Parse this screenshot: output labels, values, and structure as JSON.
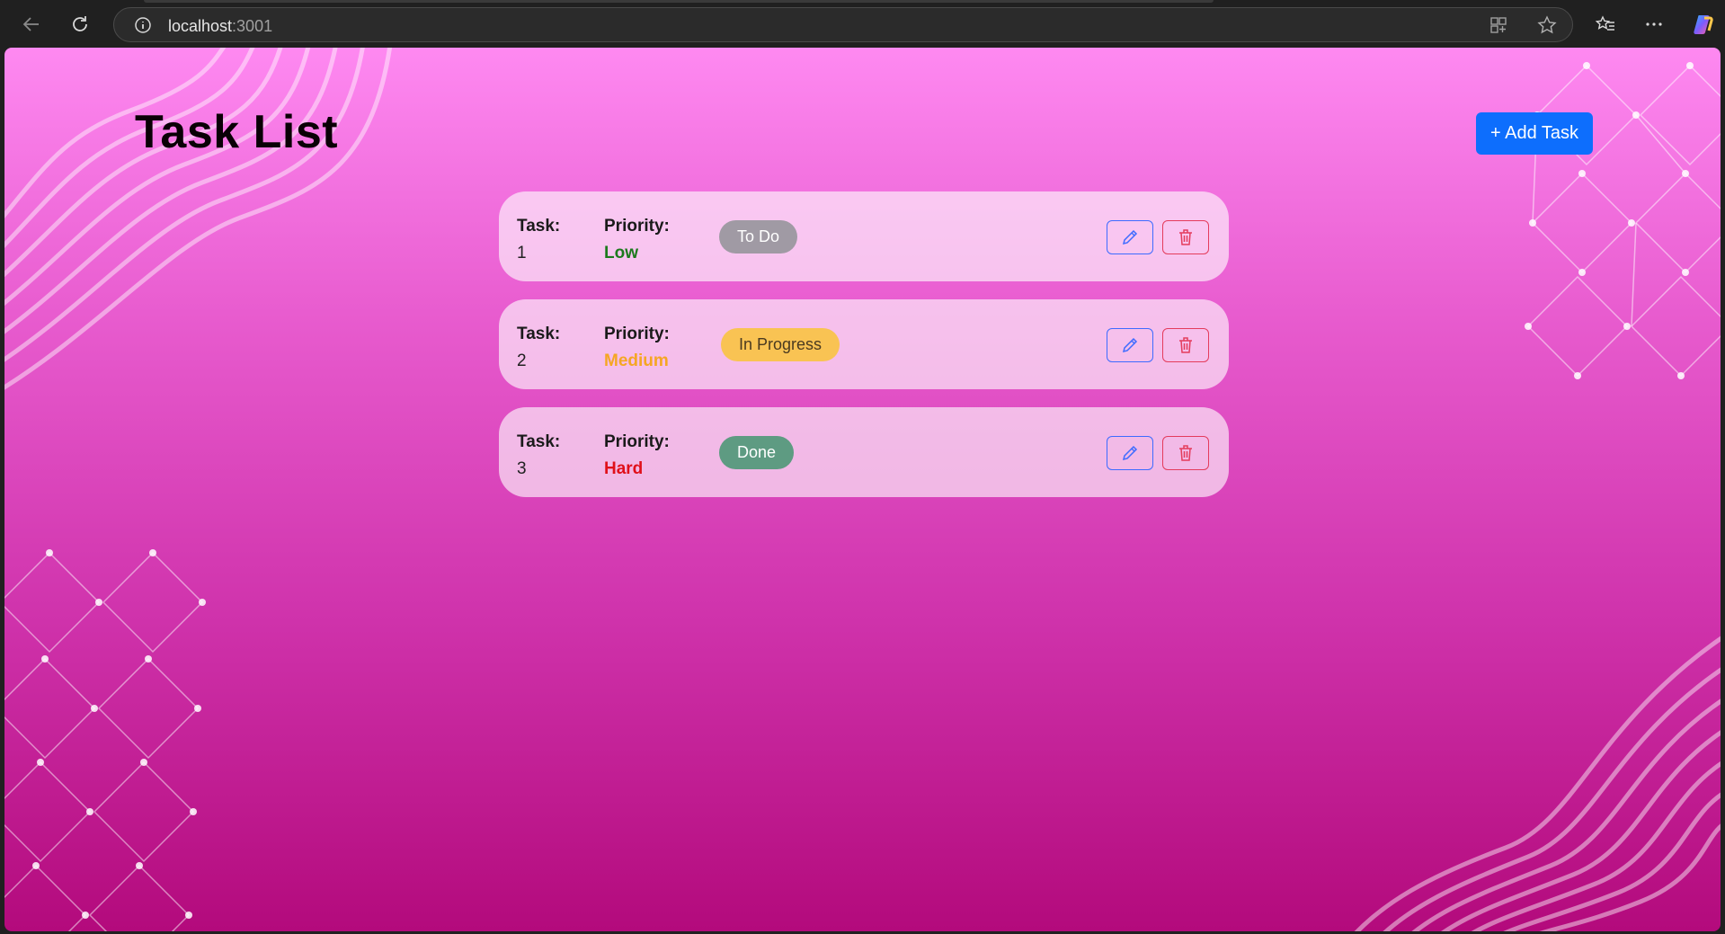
{
  "browser": {
    "address_host": "localhost",
    "address_port": ":3001",
    "icons": [
      "back-arrow-icon",
      "reload-icon",
      "info-icon",
      "app-grid-icon",
      "star-icon",
      "favorites-icon",
      "more-icon",
      "copilot-icon"
    ]
  },
  "page": {
    "title": "Task List",
    "add_button_label": "+ Add Task"
  },
  "colors": {
    "accent": "#0d6efd",
    "priority_low": "#1d7a1d",
    "priority_medium": "#f5a623",
    "priority_hard": "#e0101a",
    "status_todo": "#a09aa4",
    "status_in_progress": "#f9c353",
    "status_done": "#5e9b82",
    "edit_border": "#3d6bff",
    "delete_border": "#e43c5c"
  },
  "tasks": [
    {
      "task_label": "Task:",
      "task_value": "1",
      "priority_label": "Priority:",
      "priority_value": "Low",
      "status": "To Do"
    },
    {
      "task_label": "Task:",
      "task_value": "2",
      "priority_label": "Priority:",
      "priority_value": "Medium",
      "status": "In Progress"
    },
    {
      "task_label": "Task:",
      "task_value": "3",
      "priority_label": "Priority:",
      "priority_value": "Hard",
      "status": "Done"
    }
  ]
}
